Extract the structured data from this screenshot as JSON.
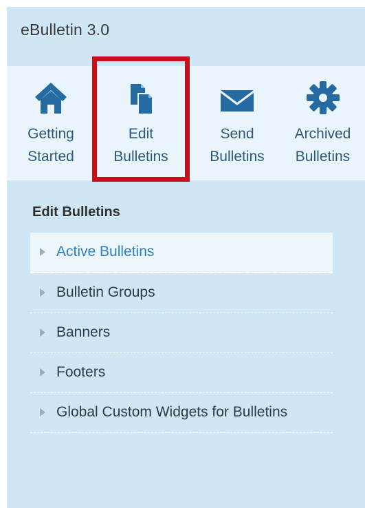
{
  "app": {
    "title": "eBulletin 3.0"
  },
  "toolbar": {
    "items": [
      {
        "line1": "Getting",
        "line2": "Started",
        "icon": "home-icon"
      },
      {
        "line1": "Edit",
        "line2": "Bulletins",
        "icon": "documents-icon",
        "selected": true
      },
      {
        "line1": "Send",
        "line2": "Bulletins",
        "icon": "envelope-icon"
      },
      {
        "line1": "Archived",
        "line2": "Bulletins",
        "icon": "gear-icon"
      }
    ],
    "highlight_color": "#c5101b"
  },
  "section": {
    "heading": "Edit Bulletins",
    "items": [
      {
        "label": "Active Bulletins",
        "active": true
      },
      {
        "label": "Bulletin Groups"
      },
      {
        "label": "Banners"
      },
      {
        "label": "Footers"
      },
      {
        "label": "Global Custom Widgets for Bulletins"
      }
    ]
  },
  "colors": {
    "panel": "#cfe6f5",
    "toolbar": "#eaf5fb",
    "icon": "#256aa0",
    "active_link": "#2f7fc0"
  }
}
